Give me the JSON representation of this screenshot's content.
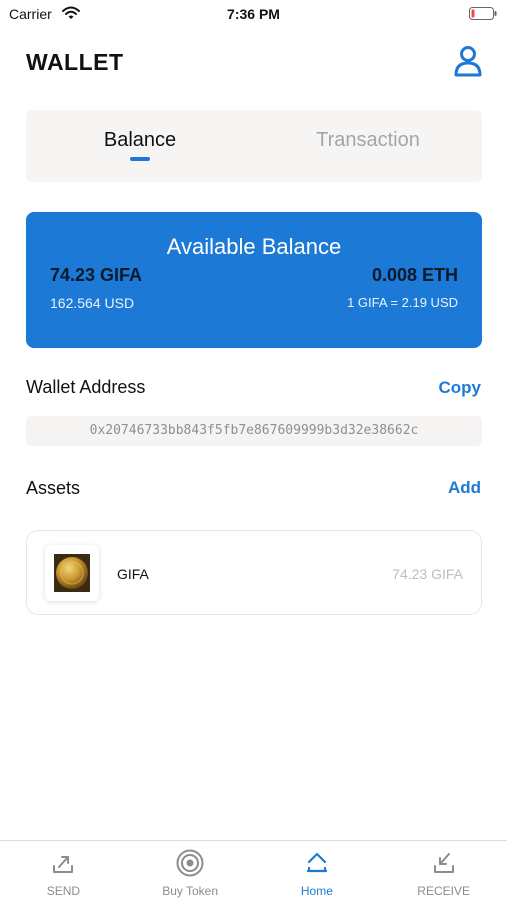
{
  "status_bar": {
    "carrier": "Carrier",
    "time": "7:36 PM",
    "battery_color": "#e74c3c"
  },
  "header": {
    "title": "WALLET",
    "profile_icon": "user-icon"
  },
  "tabs": [
    {
      "label": "Balance",
      "active": true
    },
    {
      "label": "Transaction",
      "active": false
    }
  ],
  "balance_card": {
    "title": "Available Balance",
    "gifa_amount": "74.23 GIFA",
    "eth_amount": "0.008 ETH",
    "usd_amount": "162.564 USD",
    "rate": "1 GIFA = 2.19 USD",
    "color": "#1c7ad6"
  },
  "wallet_address": {
    "label": "Wallet Address",
    "action": "Copy",
    "value": "0x20746733bb843f5fb7e867609999b3d32e38662c"
  },
  "assets": {
    "label": "Assets",
    "action": "Add",
    "items": [
      {
        "name": "GIFA",
        "amount": "74.23 GIFA",
        "icon": "gold-coin-icon"
      }
    ]
  },
  "bottom_nav": [
    {
      "label": "SEND",
      "icon": "send-icon",
      "active": false
    },
    {
      "label": "Buy Token",
      "icon": "target-icon",
      "active": false
    },
    {
      "label": "Home",
      "icon": "home-icon",
      "active": true
    },
    {
      "label": "RECEIVE",
      "icon": "receive-icon",
      "active": false
    }
  ],
  "colors": {
    "accent": "#1c7ad6",
    "inactive": "#8c8c8c"
  }
}
